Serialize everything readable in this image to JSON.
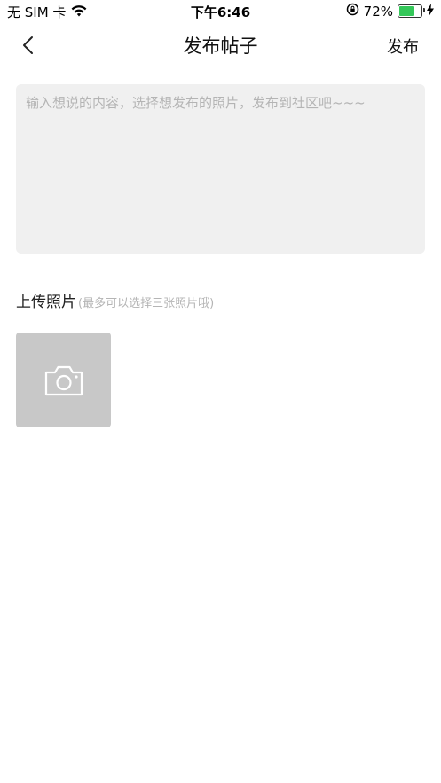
{
  "status_bar": {
    "carrier": "无 SIM 卡",
    "time": "下午6:46",
    "battery_percent": "72%",
    "battery_level": 0.72,
    "battery_color": "#34c759"
  },
  "nav": {
    "back_icon": "chevron-left-icon",
    "title": "发布帖子",
    "publish_label": "发布"
  },
  "post": {
    "placeholder": "输入想说的内容，选择想发布的照片，发布到社区吧~~~",
    "value": ""
  },
  "upload": {
    "title": "上传照片",
    "hint": "(最多可以选择三张照片哦)",
    "add_icon": "camera-icon"
  },
  "colors": {
    "input_bg": "#f0f0f0",
    "photo_slot_bg": "#c8c8c8",
    "hint_text": "#b5b5b5"
  }
}
